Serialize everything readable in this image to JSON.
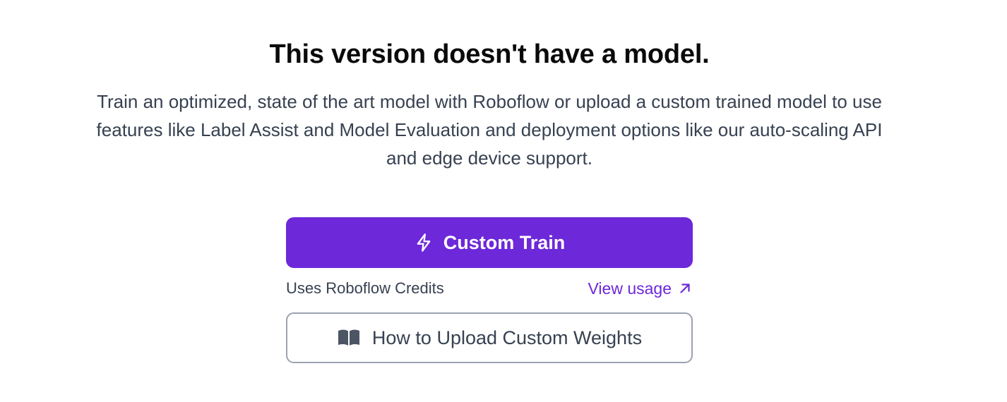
{
  "empty_state": {
    "title": "This version doesn't have a model.",
    "description": "Train an optimized, state of the art model with Roboflow or upload a custom trained model to use features like Label Assist and Model Evaluation and deployment options like our auto-scaling API and edge device support."
  },
  "actions": {
    "custom_train": {
      "label": "Custom Train",
      "icon": "lightning-bolt-icon"
    },
    "credits_note": "Uses Roboflow Credits",
    "view_usage": {
      "label": "View usage",
      "icon": "arrow-up-right-icon"
    },
    "upload_weights": {
      "label": "How to Upload Custom Weights",
      "icon": "open-book-icon"
    }
  },
  "colors": {
    "accent": "#6d28d9",
    "text": "#374151",
    "title": "#0a0a0a",
    "border": "#9ca3af"
  }
}
